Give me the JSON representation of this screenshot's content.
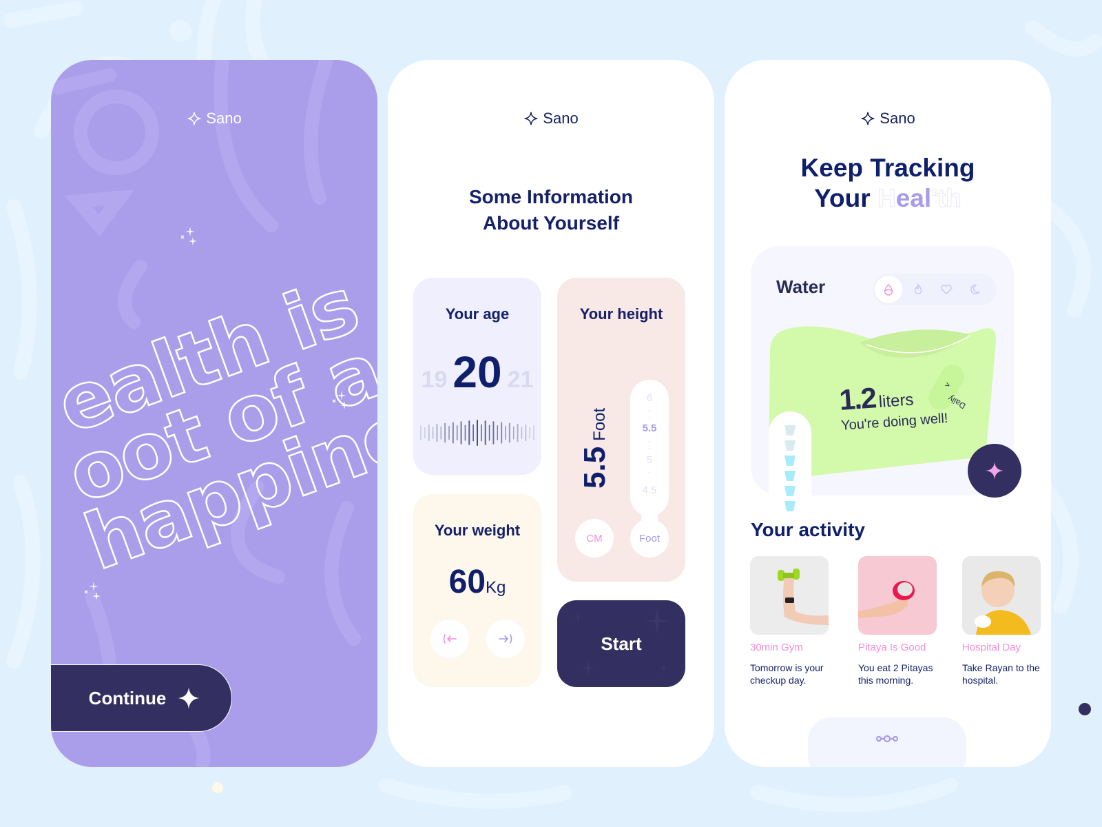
{
  "brand": {
    "name": "Sano"
  },
  "colors": {
    "background": "#e0f0fd",
    "purple": "#aa9eeb",
    "navy": "#332f60",
    "text_dark": "#0f1f6b",
    "pink": "#f48dd8",
    "lavender": "#a79be8",
    "water_green": "#d3f9ab",
    "cup_filled": "#a8ecfb",
    "cup_empty": "#d8ecef"
  },
  "screen_welcome": {
    "slogan_lines": [
      "ealth is",
      "oot of a",
      "happine"
    ],
    "slogan_full": "Health is root of all happiness",
    "continue_label": "Continue",
    "continue_icon": "sparkle-icon"
  },
  "screen_info": {
    "title_line1": "Some Information",
    "title_line2": "About Yourself",
    "age": {
      "label": "Your age",
      "prev": "19",
      "value": "20",
      "next": "21"
    },
    "height": {
      "label": "Your height",
      "value": "5.5",
      "unit": "Foot",
      "scale": [
        "6",
        "5.5",
        "5",
        "4.5"
      ],
      "selected": "5.5",
      "unit_options": [
        "CM",
        "Foot"
      ],
      "selected_unit": "Foot"
    },
    "weight": {
      "label": "Your weight",
      "value": "60",
      "unit": "Kg",
      "prev_icon": "arrow-left-icon",
      "next_icon": "arrow-right-icon"
    },
    "start_label": "Start"
  },
  "screen_tracking": {
    "title_line1": "Keep Tracking",
    "title_line2_prefix": "Your",
    "title_line2_ghost_pre": "H",
    "title_line2_ghost_highlight": "eal",
    "title_line2_ghost_post": "'th",
    "water": {
      "label": "Water",
      "tabs": [
        {
          "icon": "water-drop-icon",
          "active": true
        },
        {
          "icon": "flame-icon",
          "active": false
        },
        {
          "icon": "heart-icon",
          "active": false
        },
        {
          "icon": "moon-icon",
          "active": false
        }
      ],
      "amount": "1.2",
      "unit": "liters",
      "message": "You're doing well!",
      "period": "Daily",
      "cups_total": 6,
      "cups_filled": 4
    },
    "activity_title": "Your activity",
    "activities": [
      {
        "title": "30min Gym",
        "desc": "Tomorrow is your checkup day.",
        "image": "arm-dumbbell-photo"
      },
      {
        "title": "Pitaya Is Good",
        "desc": "You eat 2 Pitayas this morning.",
        "image": "hand-pitaya-photo"
      },
      {
        "title": "Hospital Day",
        "desc": "Take Rayan to the hospital.",
        "image": "child-bandage-photo"
      }
    ],
    "nav_icon": "nodes-icon"
  }
}
